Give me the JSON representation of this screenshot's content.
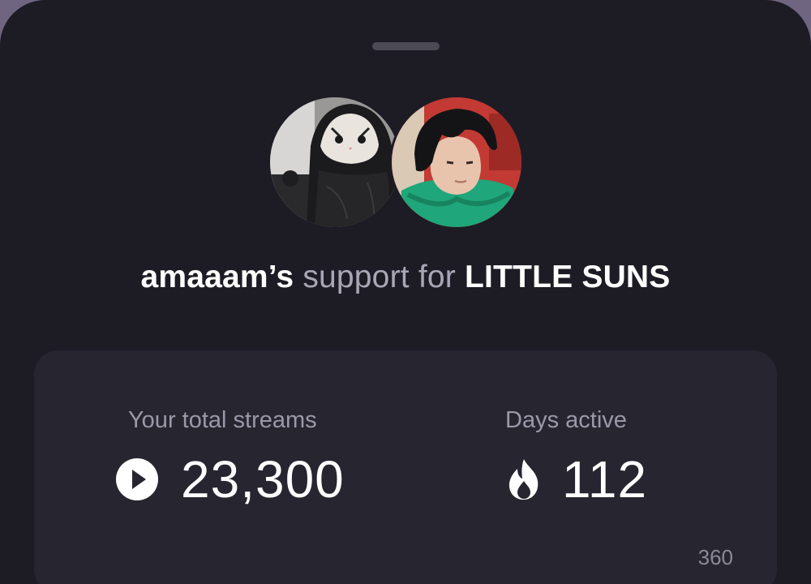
{
  "header": {
    "username": "amaaam’s",
    "connector": " support for ",
    "artist": "LITTLE SUNS"
  },
  "stats": {
    "total_streams_label": "Your total streams",
    "total_streams_value": "23,300",
    "days_active_label": "Days active",
    "days_active_value": "112"
  },
  "chart": {
    "tick_label": "360"
  },
  "icons": {
    "streams": "play-icon",
    "days": "flame-icon"
  },
  "colors": {
    "background": "#1d1c25",
    "card": "#262530",
    "text_primary": "#ffffff",
    "text_muted": "#a9a7b5"
  }
}
